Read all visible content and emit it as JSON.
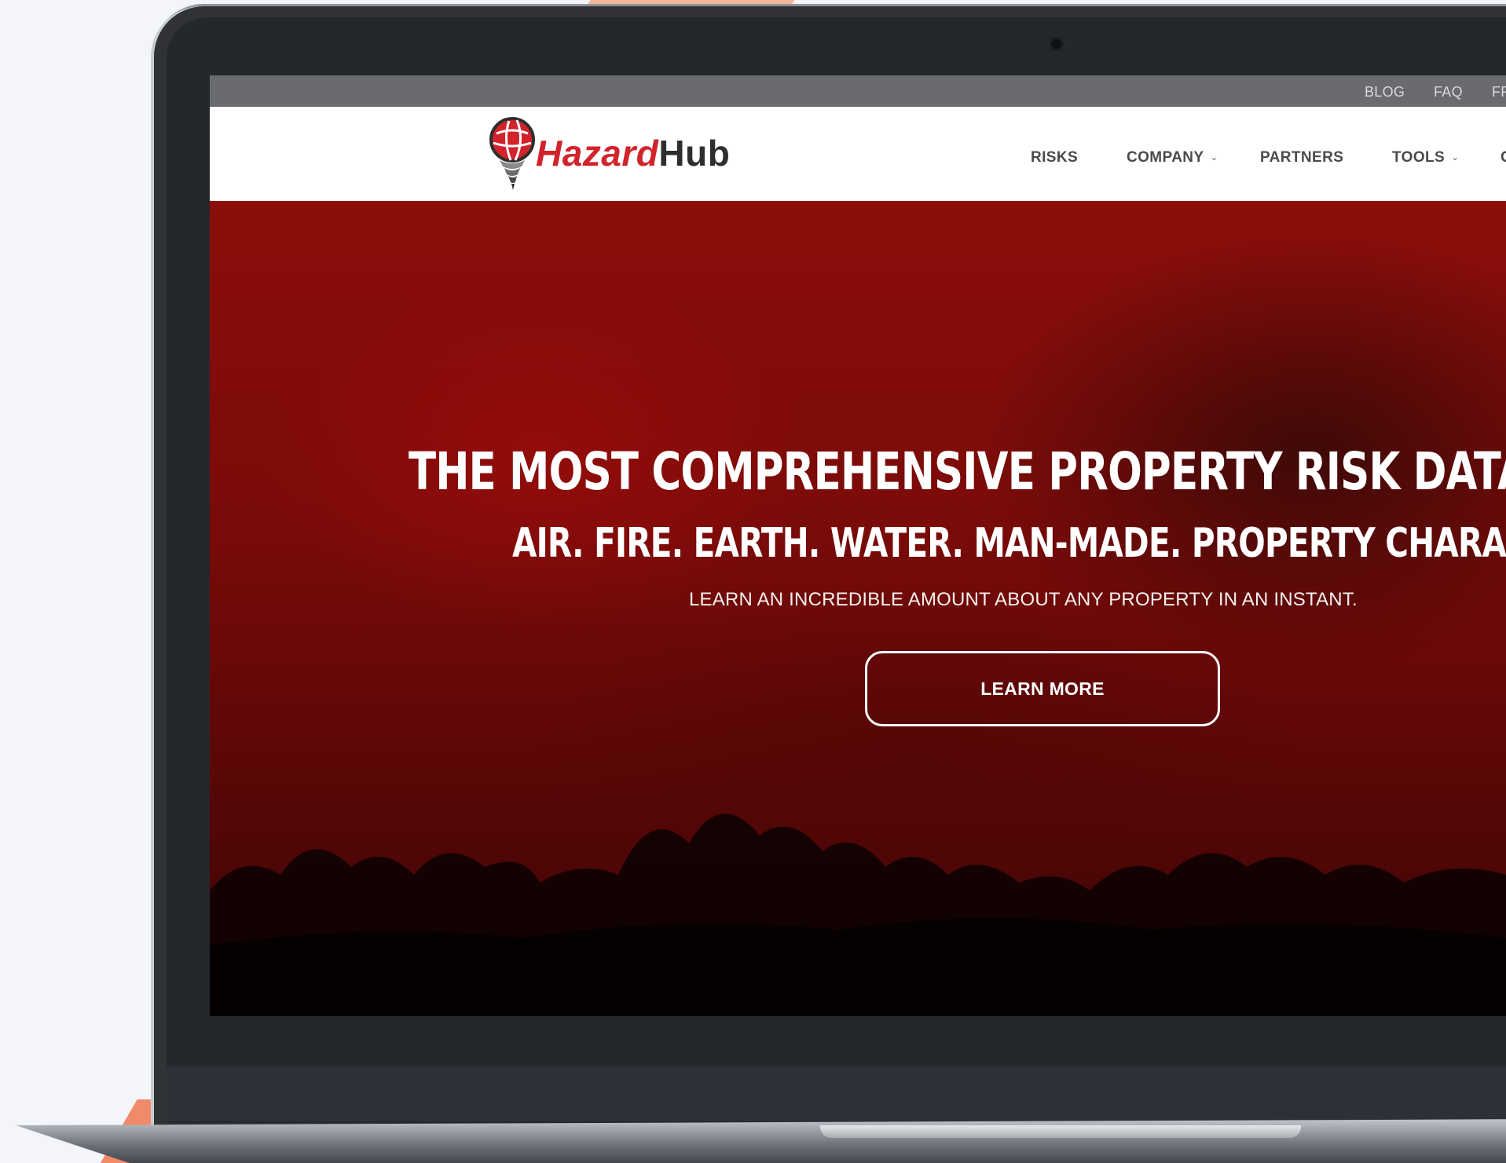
{
  "topbar": {
    "links": [
      {
        "label": "BLOG"
      },
      {
        "label": "FAQ"
      },
      {
        "label": "FR"
      }
    ]
  },
  "brand": {
    "name_part1": "Hazard",
    "name_part2": "Hub",
    "primary_color": "#d2232a",
    "dark_color": "#2e2e2e",
    "icon": "globe-tornado-logo-icon"
  },
  "nav": {
    "items": [
      {
        "label": "RISKS",
        "has_dropdown": false
      },
      {
        "label": "COMPANY",
        "has_dropdown": true
      },
      {
        "label": "PARTNERS",
        "has_dropdown": false
      },
      {
        "label": "TOOLS",
        "has_dropdown": true
      },
      {
        "label": "C",
        "has_dropdown": false
      }
    ],
    "dropdown_icon": "chevron-down-icon"
  },
  "hero": {
    "title": "THE MOST COMPREHENSIVE PROPERTY RISK DATA EVER C",
    "subtitle": "AIR. FIRE. EARTH. WATER. MAN-MADE. PROPERTY CHARACTERIST",
    "tagline": "LEARN AN INCREDIBLE AMOUNT ABOUT ANY PROPERTY IN AN INSTANT.",
    "cta_label": "LEARN MORE",
    "background_color": "#7a0b09"
  }
}
